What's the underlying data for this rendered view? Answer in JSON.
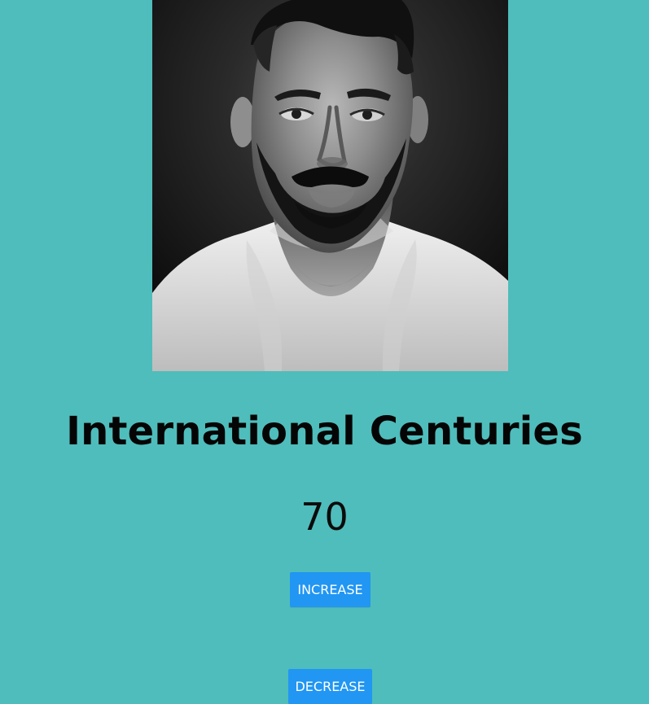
{
  "hero": {
    "image_alt": "Portrait",
    "title": "International Centuries",
    "count": "70"
  },
  "actions": {
    "increase_label": "INCREASE",
    "decrease_label": "DECREASE"
  },
  "colors": {
    "background": "#4fbdbb",
    "button": "#2196f3",
    "button_text": "#ffffff",
    "text": "#050505"
  },
  "icons": {
    "photo": "portrait-image"
  }
}
